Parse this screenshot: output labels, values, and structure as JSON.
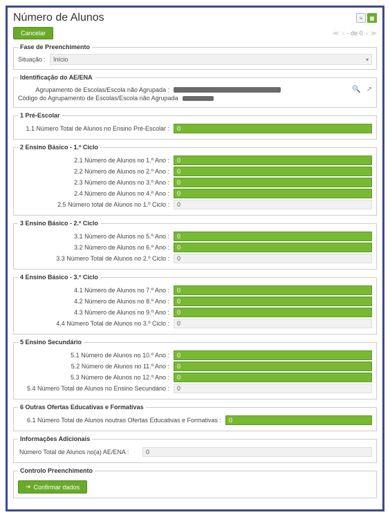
{
  "page": {
    "title": "Número de Alunos"
  },
  "toolbar": {
    "cancel": "Cancelar"
  },
  "pager": {
    "text": "- de 0"
  },
  "fase": {
    "legend": "Fase de Preenchimento",
    "situacao_label": "Situação :",
    "situacao_value": "Início"
  },
  "ident": {
    "legend": "Identificação do AE/ENA",
    "agrup_label": "Agrupamento de Escolas/Escola não Agrupada :",
    "codigo_label": "Código do Agrupamento de Escolas/Escola não Agrupada"
  },
  "s1": {
    "legend": "1 Pré-Escolar",
    "r1_label": "1.1 Número Total de Alunos no Ensino Pré-Escolar :",
    "r1_val": "0"
  },
  "s2": {
    "legend": "2 Ensino Básico - 1.º Ciclo",
    "r1_label": "2.1 Número de Alunos no 1.º Ano :",
    "r1_val": "0",
    "r2_label": "2.2 Número de Alunos no 2.º Ano :",
    "r2_val": "0",
    "r3_label": "2.3 Número de Alunos no 3.º Ano :",
    "r3_val": "0",
    "r4_label": "2.4 Número de Alunos no 4.º Ano :",
    "r4_val": "0",
    "r5_label": "2.5 Número total de Alunos no 1.º Ciclo :",
    "r5_val": "0"
  },
  "s3": {
    "legend": "3 Ensino Básico - 2.º Ciclo",
    "r1_label": "3.1 Número de Alunos no 5.º Ano :",
    "r1_val": "0",
    "r2_label": "3.2 Número de Alunos no 6.º Ano :",
    "r2_val": "0",
    "r3_label": "3.3 Número Total de Alunos no 2.º Ciclo :",
    "r3_val": "0"
  },
  "s4": {
    "legend": "4 Ensino Básico - 3.º Ciclo",
    "r1_label": "4.1 Número de Alunos no 7.º Ano :",
    "r1_val": "0",
    "r2_label": "4.2 Número de Alunos no 8.º Ano :",
    "r2_val": "0",
    "r3_label": "4.3 Número de Alunos no 9.º Ano :",
    "r3_val": "0",
    "r4_label": "4.4 Número Total de Alunos no 3.º Ciclo :",
    "r4_val": "0"
  },
  "s5": {
    "legend": "5 Ensino Secundário",
    "r1_label": "5.1 Número de Alunos no 10.º Ano :",
    "r1_val": "0",
    "r2_label": "5.2 Número de Alunos no 11.º Ano :",
    "r2_val": "0",
    "r3_label": "5.3 Número de Alunos no 12.º Ano :",
    "r3_val": "0",
    "r4_label": "5.4 Número Total de Alunos no Ensino Secundário :",
    "r4_val": "0"
  },
  "s6": {
    "legend": "6 Outras Ofertas Educativas e Formativas",
    "r1_label": "6.1 Número Total de Alunos noutras Ofertas Educativas e Formativas :",
    "r1_val": "0"
  },
  "info": {
    "legend": "Informações Adicionais",
    "r1_label": "Número Total de Alunos no(a) AE/ENA :",
    "r1_val": "0"
  },
  "controlo": {
    "legend": "Controlo Preenchimento",
    "confirm": "Confirmar dados"
  }
}
